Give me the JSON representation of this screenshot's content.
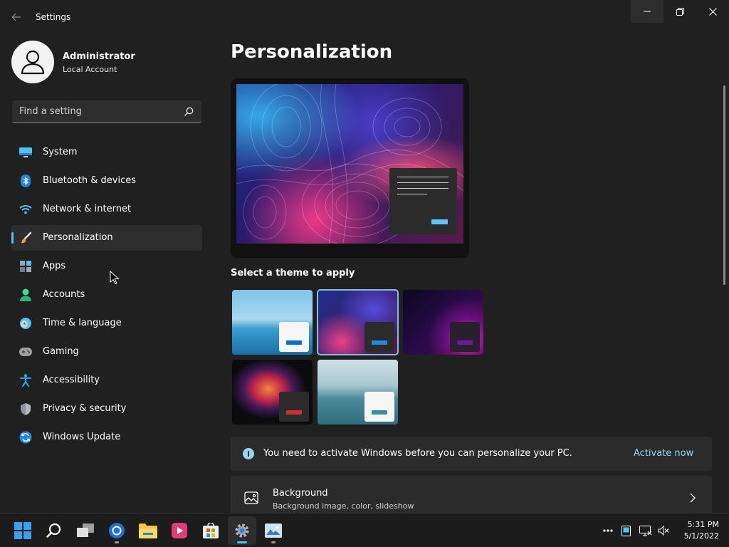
{
  "window": {
    "title": "Settings"
  },
  "profile": {
    "name": "Administrator",
    "account_type": "Local Account"
  },
  "search": {
    "placeholder": "Find a setting"
  },
  "sidebar": {
    "items": [
      {
        "label": "System",
        "icon": "system-icon",
        "active": false
      },
      {
        "label": "Bluetooth & devices",
        "icon": "bluetooth-icon",
        "active": false
      },
      {
        "label": "Network & internet",
        "icon": "wifi-icon",
        "active": false
      },
      {
        "label": "Personalization",
        "icon": "brush-icon",
        "active": true
      },
      {
        "label": "Apps",
        "icon": "apps-icon",
        "active": false
      },
      {
        "label": "Accounts",
        "icon": "person-icon",
        "active": false
      },
      {
        "label": "Time & language",
        "icon": "clock-icon",
        "active": false
      },
      {
        "label": "Gaming",
        "icon": "gamepad-icon",
        "active": false
      },
      {
        "label": "Accessibility",
        "icon": "accessibility-icon",
        "active": false
      },
      {
        "label": "Privacy & security",
        "icon": "shield-icon",
        "active": false
      },
      {
        "label": "Windows Update",
        "icon": "update-icon",
        "active": false
      }
    ]
  },
  "main": {
    "title": "Personalization",
    "theme_heading": "Select a theme to apply",
    "activation": {
      "message": "You need to activate Windows before you can personalize your PC.",
      "action": "Activate now"
    },
    "background": {
      "title": "Background",
      "subtitle": "Background image, color, slideshow"
    }
  },
  "taskbar": {
    "time": "5:31 PM",
    "date": "5/1/2022"
  },
  "colors": {
    "accent": "#4cc2ff",
    "link": "#99d5f3",
    "surface": "#2b2b2b",
    "background": "#202020"
  }
}
